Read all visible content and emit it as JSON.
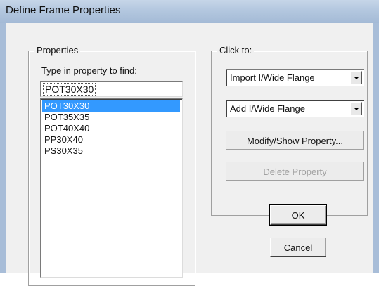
{
  "window": {
    "title": "Define Frame Properties"
  },
  "properties_group": {
    "legend": "Properties",
    "find_label": "Type in property to find:",
    "find_value": "POT30X30",
    "items": [
      "POT30X30",
      "POT35X35",
      "POT40X40",
      "PP30X40",
      "PS30X35"
    ],
    "selected_item": "POT30X30"
  },
  "click_group": {
    "legend": "Click to:",
    "import_combo": "Import I/Wide Flange",
    "add_combo": "Add I/Wide Flange",
    "modify_button": "Modify/Show Property...",
    "delete_button": "Delete Property"
  },
  "buttons": {
    "ok": "OK",
    "cancel": "Cancel"
  },
  "colors": {
    "selection": "#3399ff",
    "title_bar": "#b3c7df",
    "dialog_bg": "#f0f0f0"
  }
}
